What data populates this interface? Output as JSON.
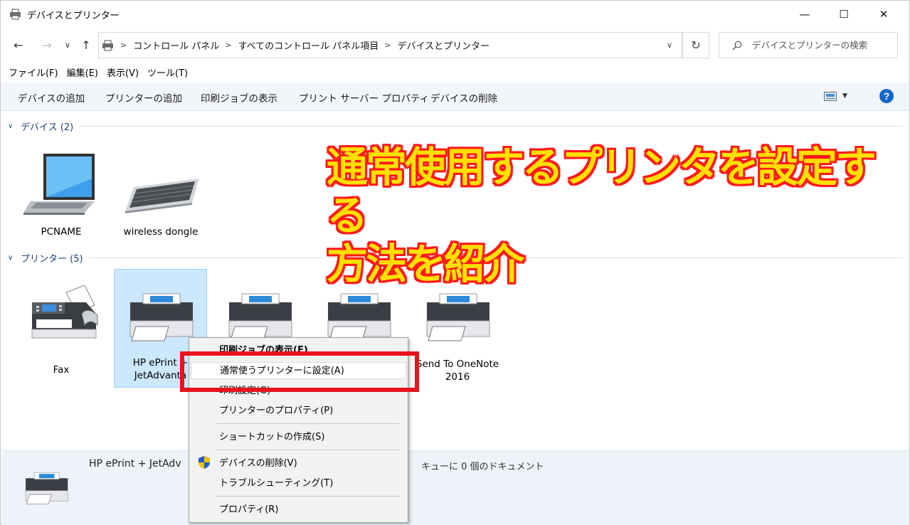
{
  "window": {
    "title": "デバイスとプリンター"
  },
  "controls": {
    "minimize": "—",
    "maximize": "☐",
    "close": "✕"
  },
  "nav": {
    "back": "←",
    "forward": "→",
    "recent": "∨",
    "up": "↑",
    "refresh": "↻",
    "dropdown": "∨"
  },
  "breadcrumb": [
    "コントロール パネル",
    "すべてのコントロール パネル項目",
    "デバイスとプリンター"
  ],
  "breadcrumb_sep": ">",
  "search": {
    "placeholder": "デバイスとプリンターの検索"
  },
  "menu": [
    "ファイル(F)",
    "編集(E)",
    "表示(V)",
    "ツール(T)"
  ],
  "commands": [
    "デバイスの追加",
    "プリンターの追加",
    "印刷ジョブの表示",
    "プリント サーバー プロパティ",
    "デバイスの削除"
  ],
  "help": "?",
  "groups": {
    "devices": {
      "title": "デバイス (2)",
      "items": [
        "PCNAME",
        "wireless dongle"
      ]
    },
    "printers": {
      "title": "プリンター (5)",
      "items": {
        "fax": "Fax",
        "hp_line1": "HP ePrint +",
        "hp_line2": "JetAdvanta",
        "onenote_line1": "Send To OneNote",
        "onenote_line2": "2016"
      }
    }
  },
  "promo": {
    "line1": "通常使用するプリンタを設定する",
    "line2": "方法を紹介"
  },
  "details": {
    "name": "HP ePrint + JetAdv",
    "status_key": ":",
    "status": "キューに 0 個のドキュメント"
  },
  "context_menu": {
    "see_jobs": "印刷ジョブの表示(E)",
    "set_default": "通常使うプリンターに設定(A)",
    "print_prefs": "印刷設定(G)",
    "printer_props": "プリンターのプロパティ(P)",
    "create_shortcut": "ショートカットの作成(S)",
    "remove_device": "デバイスの削除(V)",
    "troubleshoot": "トラブルシューティング(T)",
    "properties": "プロパティ(R)"
  },
  "colors": {
    "accent": "#1466c7",
    "selection": "#cce8ff",
    "highlight_box": "#e8141c",
    "promo_fill": "#ffe000",
    "promo_stroke": "#ff1a1a"
  }
}
